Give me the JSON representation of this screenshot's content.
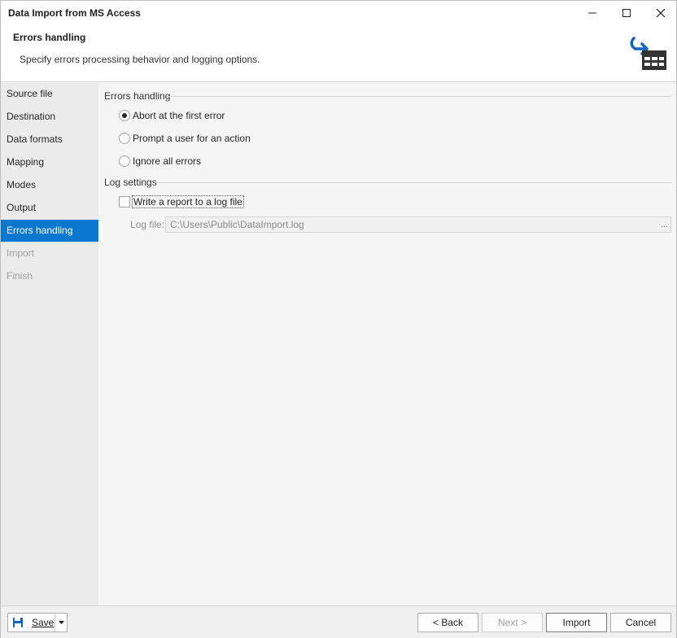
{
  "window": {
    "title": "Data Import from MS Access"
  },
  "header": {
    "title": "Errors handling",
    "description": "Specify errors processing behavior and logging options.",
    "icon": "import-table-icon"
  },
  "sidebar": {
    "items": [
      {
        "label": "Source file",
        "state": "normal"
      },
      {
        "label": "Destination",
        "state": "normal"
      },
      {
        "label": "Data formats",
        "state": "normal"
      },
      {
        "label": "Mapping",
        "state": "normal"
      },
      {
        "label": "Modes",
        "state": "normal"
      },
      {
        "label": "Output",
        "state": "normal"
      },
      {
        "label": "Errors handling",
        "state": "active"
      },
      {
        "label": "Import",
        "state": "disabled"
      },
      {
        "label": "Finish",
        "state": "disabled"
      }
    ]
  },
  "errors_group": {
    "label": "Errors handling",
    "options": [
      {
        "label": "Abort at the first error",
        "checked": true
      },
      {
        "label": "Prompt a user for an action",
        "checked": false
      },
      {
        "label": "Ignore all errors",
        "checked": false
      }
    ]
  },
  "log_group": {
    "label": "Log settings",
    "write_report_label": "Write a report to a log file",
    "write_report_checked": false,
    "log_file_label": "Log file:",
    "log_file_value": "C:\\Users\\Public\\DataImport.log",
    "browse_label": "..."
  },
  "footer": {
    "save_label": "Save",
    "back_label": "< Back",
    "next_label": "Next >",
    "import_label": "Import",
    "cancel_label": "Cancel"
  },
  "colors": {
    "accent": "#0b78d0",
    "icon_blue": "#1565c0",
    "icon_dark": "#333333"
  }
}
